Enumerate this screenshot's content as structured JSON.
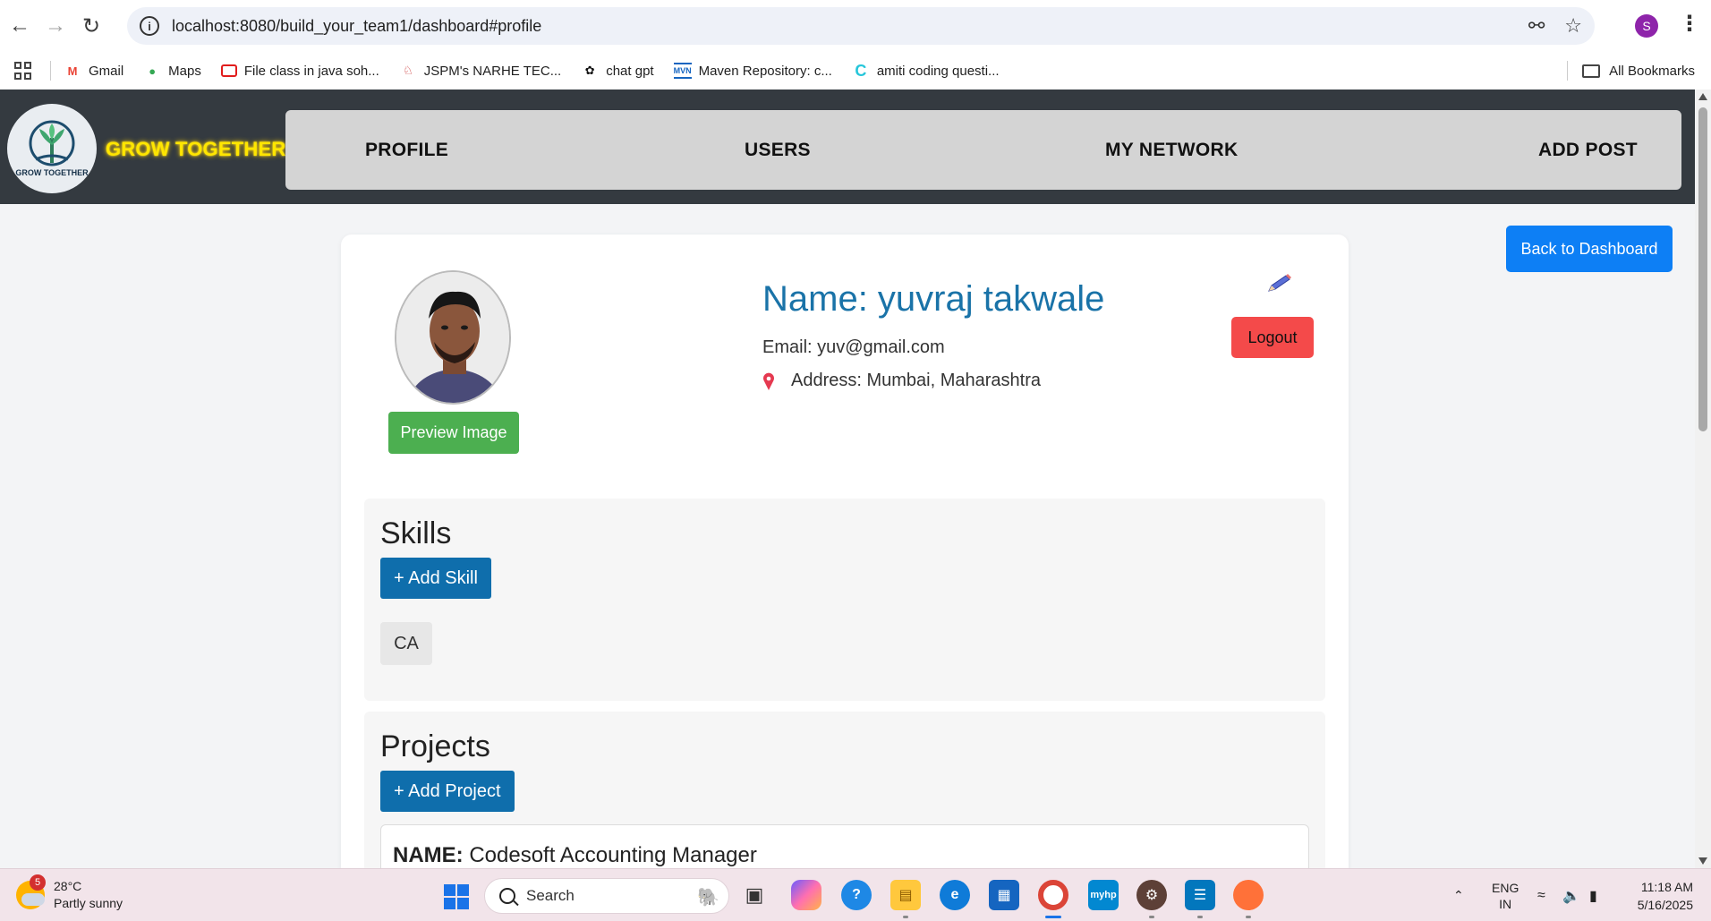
{
  "browser": {
    "url": "localhost:8080/build_your_team1/dashboard#profile",
    "profile_initial": "S",
    "bookmarks": [
      {
        "label": "Gmail",
        "icon": "gmail-icon"
      },
      {
        "label": "Maps",
        "icon": "maps-icon"
      },
      {
        "label": "File class in java soh...",
        "icon": "oracle-icon"
      },
      {
        "label": "JSPM's NARHE TEC...",
        "icon": "jspm-icon"
      },
      {
        "label": "chat gpt",
        "icon": "chatgpt-icon"
      },
      {
        "label": "Maven Repository: c...",
        "icon": "maven-icon"
      },
      {
        "label": "amiti coding questi...",
        "icon": "amiti-icon"
      }
    ],
    "all_bookmarks": "All Bookmarks"
  },
  "header": {
    "logo_text": "GROW TOGETHER",
    "brand": "GROW TOGETHER",
    "nav": [
      "PROFILE",
      "USERS",
      "MY NETWORK",
      "ADD POST"
    ]
  },
  "actions": {
    "back_to_dashboard": "Back to Dashboard"
  },
  "profile": {
    "preview_button": "Preview Image",
    "name": "Name: yuvraj takwale",
    "email": "Email: yuv@gmail.com",
    "address": "Address: Mumbai, Maharashtra",
    "logout": "Logout"
  },
  "skills": {
    "heading": "Skills",
    "add_button": "+ Add Skill",
    "items": [
      "CA"
    ]
  },
  "projects": {
    "heading": "Projects",
    "add_button": "+ Add Project",
    "items": [
      {
        "label": "NAME:",
        "name": "Codesoft Accounting Manager"
      }
    ]
  },
  "taskbar": {
    "weather_badge": "5",
    "temperature": "28°C",
    "condition": "Partly sunny",
    "search_placeholder": "Search",
    "language": "ENG",
    "region": "IN",
    "time": "11:18 AM",
    "date": "5/16/2025"
  },
  "colors": {
    "header_bg": "#343a40",
    "brand_yellow": "#ffe600",
    "primary_blue": "#0d7ff5",
    "name_blue": "#1a73a8",
    "logout_red": "#f44a4a",
    "preview_green": "#4caf50",
    "add_blue": "#0f6eac"
  }
}
